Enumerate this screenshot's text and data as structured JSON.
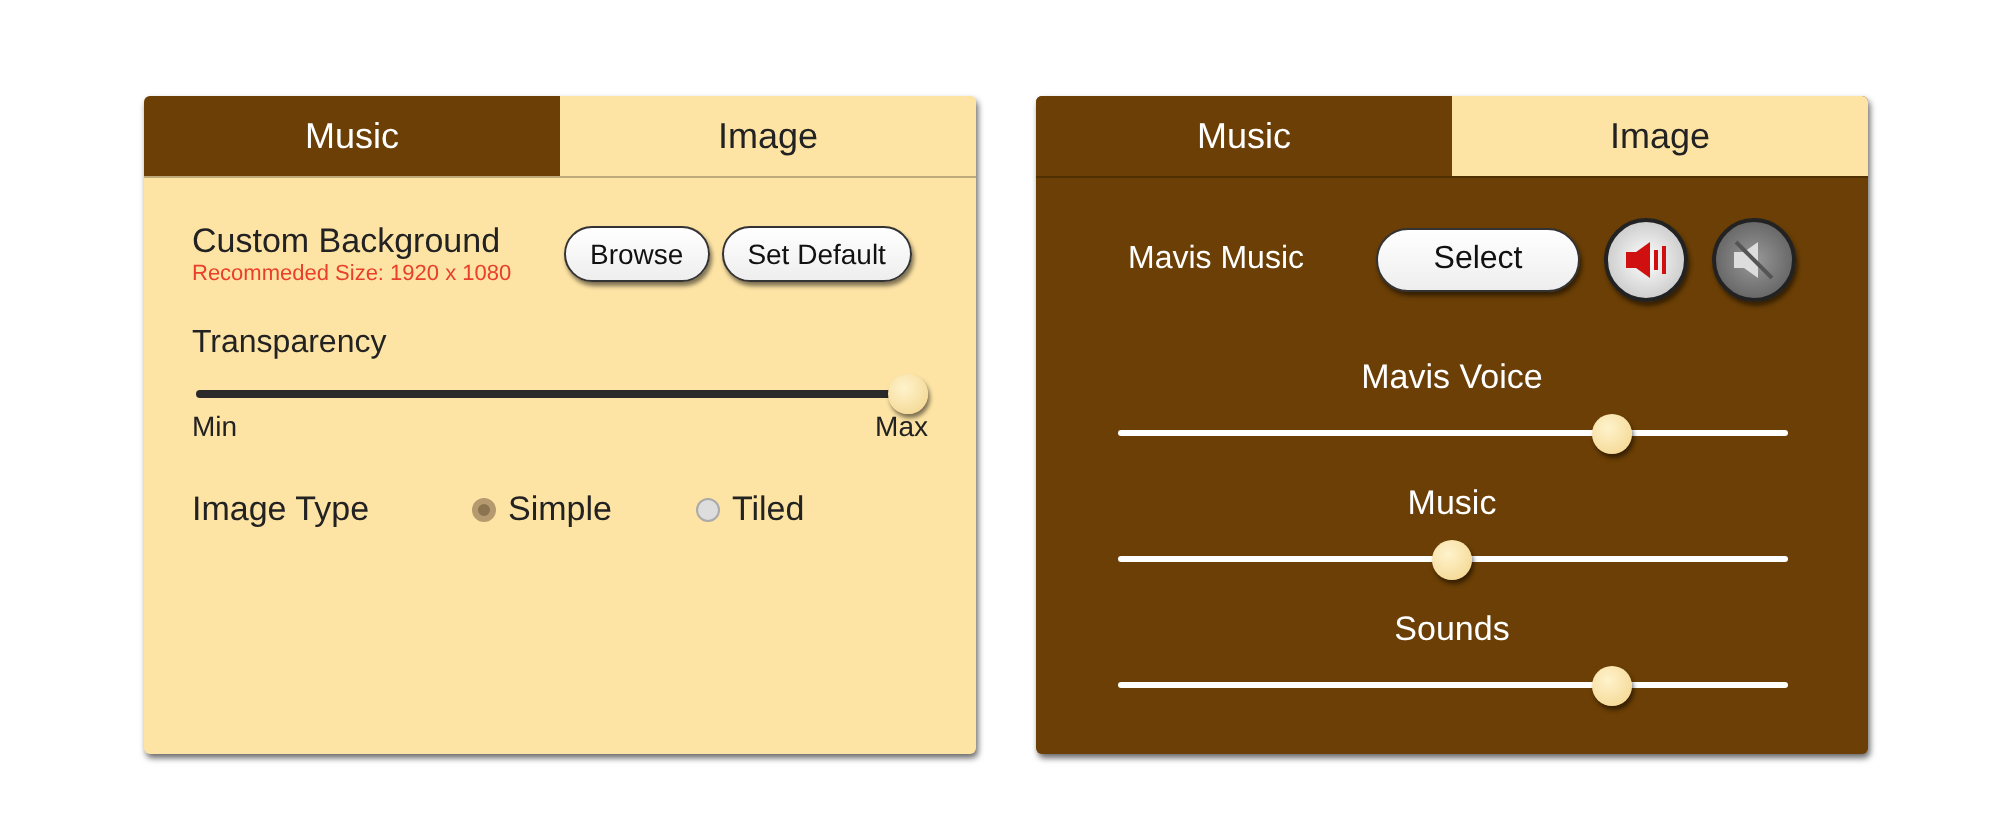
{
  "panels": [
    {
      "tabs": [
        {
          "label": "Music",
          "selected": false
        },
        {
          "label": "Image",
          "selected": true
        }
      ],
      "content": {
        "kind": "image",
        "title": "Custom Background",
        "note": "Recommeded Size: 1920 x 1080",
        "buttons": [
          "Browse",
          "Set Default"
        ],
        "slider": {
          "label": "Transparency",
          "level": 1.0,
          "min_label": "Min",
          "max_label": "Max"
        },
        "image_type": {
          "label": "Image Type",
          "options": [
            {
              "label": "Simple",
              "selected": true
            },
            {
              "label": "Tiled",
              "selected": false
            }
          ]
        }
      }
    },
    {
      "tabs": [
        {
          "label": "Music",
          "selected": true
        },
        {
          "label": "Image",
          "selected": false
        }
      ],
      "content": {
        "kind": "music",
        "label": "Mavis Music",
        "button": "Select",
        "sound_buttons": [
          {
            "kind": "sound-on",
            "selected": true
          },
          {
            "kind": "sound-off",
            "selected": false
          }
        ],
        "sliders": [
          {
            "label": "Mavis Voice",
            "level": 0.74
          },
          {
            "label": "Music",
            "level": 0.5
          },
          {
            "label": "Sounds",
            "level": 0.74
          }
        ]
      }
    }
  ]
}
